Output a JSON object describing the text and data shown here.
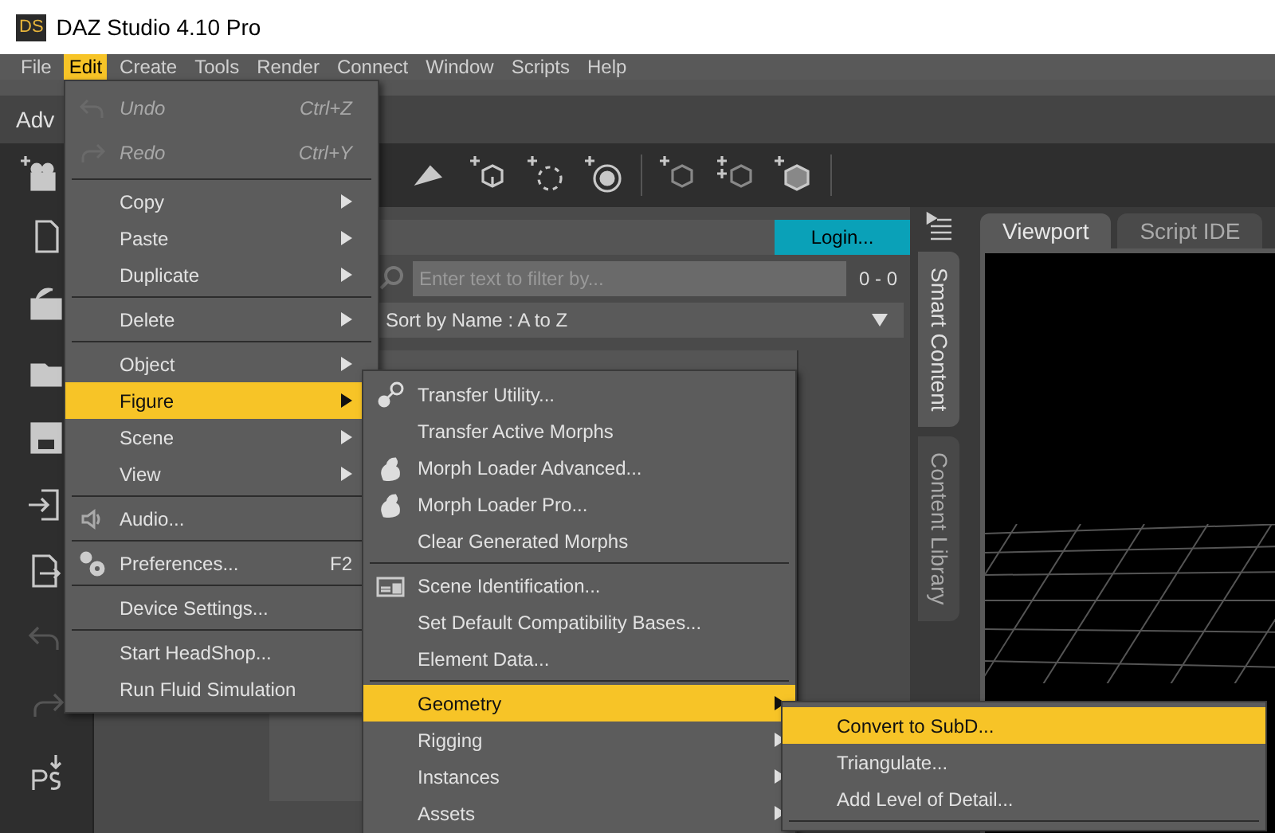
{
  "window": {
    "title": "DAZ Studio 4.10 Pro",
    "logo": "DS"
  },
  "menubar": [
    {
      "label": "File",
      "selected": false
    },
    {
      "label": "Edit",
      "selected": true
    },
    {
      "label": "Create",
      "selected": false
    },
    {
      "label": "Tools",
      "selected": false
    },
    {
      "label": "Render",
      "selected": false
    },
    {
      "label": "Connect",
      "selected": false
    },
    {
      "label": "Window",
      "selected": false
    },
    {
      "label": "Scripts",
      "selected": false
    },
    {
      "label": "Help",
      "selected": false
    }
  ],
  "layout_tab": "Adv",
  "content_panel": {
    "login_button": "Login...",
    "filter": {
      "placeholder": "Enter text to filter by..."
    },
    "count": "0 - 0",
    "sort": "Sort by Name : A to Z"
  },
  "side_tabs": [
    {
      "label": "Smart Content",
      "selected": true
    },
    {
      "label": "Content Library",
      "selected": false
    }
  ],
  "viewport_tabs": [
    {
      "label": "Viewport",
      "selected": true
    },
    {
      "label": "Script IDE",
      "selected": false
    }
  ],
  "menus": [
    {
      "items": [
        {
          "kind": "item",
          "label": "Undo",
          "shortcut": "Ctrl+Z",
          "disabled": true,
          "submenu": false,
          "selected": false
        },
        {
          "kind": "item",
          "label": "Redo",
          "shortcut": "Ctrl+Y",
          "disabled": true,
          "submenu": false,
          "selected": false
        },
        {
          "kind": "separator"
        },
        {
          "kind": "item",
          "label": "Copy",
          "disabled": false,
          "submenu": true,
          "selected": false
        },
        {
          "kind": "item",
          "label": "Paste",
          "disabled": false,
          "submenu": true,
          "selected": false
        },
        {
          "kind": "item",
          "label": "Duplicate",
          "disabled": false,
          "submenu": true,
          "selected": false
        },
        {
          "kind": "separator"
        },
        {
          "kind": "item",
          "label": "Delete",
          "disabled": false,
          "submenu": true,
          "selected": false
        },
        {
          "kind": "separator"
        },
        {
          "kind": "item",
          "label": "Object",
          "disabled": false,
          "submenu": true,
          "selected": false
        },
        {
          "kind": "item",
          "label": "Figure",
          "disabled": false,
          "submenu": true,
          "selected": true
        },
        {
          "kind": "item",
          "label": "Scene",
          "disabled": false,
          "submenu": true,
          "selected": false
        },
        {
          "kind": "item",
          "label": "View",
          "disabled": false,
          "submenu": true,
          "selected": false
        },
        {
          "kind": "separator"
        },
        {
          "kind": "item",
          "label": "Audio...",
          "disabled": false,
          "submenu": false,
          "selected": false
        },
        {
          "kind": "separator"
        },
        {
          "kind": "item",
          "label": "Preferences...",
          "shortcut": "F2",
          "disabled": false,
          "submenu": false,
          "selected": false
        },
        {
          "kind": "separator"
        },
        {
          "kind": "item",
          "label": "Device Settings...",
          "disabled": false,
          "submenu": false,
          "selected": false
        },
        {
          "kind": "separator"
        },
        {
          "kind": "item",
          "label": "Start HeadShop...",
          "disabled": false,
          "submenu": false,
          "selected": false
        },
        {
          "kind": "item",
          "label": "Run Fluid Simulation",
          "disabled": false,
          "submenu": false,
          "selected": false
        }
      ]
    },
    {
      "items": [
        {
          "kind": "item",
          "label": "Transfer Utility...",
          "disabled": false,
          "submenu": false,
          "selected": false
        },
        {
          "kind": "item",
          "label": "Transfer Active Morphs",
          "disabled": false,
          "submenu": false,
          "selected": false
        },
        {
          "kind": "item",
          "label": "Morph Loader Advanced...",
          "disabled": false,
          "submenu": false,
          "selected": false
        },
        {
          "kind": "item",
          "label": "Morph Loader Pro...",
          "disabled": false,
          "submenu": false,
          "selected": false
        },
        {
          "kind": "item",
          "label": "Clear Generated Morphs",
          "disabled": false,
          "submenu": false,
          "selected": false
        },
        {
          "kind": "separator"
        },
        {
          "kind": "item",
          "label": "Scene Identification...",
          "disabled": false,
          "submenu": false,
          "selected": false
        },
        {
          "kind": "item",
          "label": "Set Default Compatibility Bases...",
          "disabled": false,
          "submenu": false,
          "selected": false
        },
        {
          "kind": "item",
          "label": "Element Data...",
          "disabled": false,
          "submenu": false,
          "selected": false
        },
        {
          "kind": "separator"
        },
        {
          "kind": "item",
          "label": "Geometry",
          "disabled": false,
          "submenu": true,
          "selected": true
        },
        {
          "kind": "item",
          "label": "Rigging",
          "disabled": false,
          "submenu": true,
          "selected": false
        },
        {
          "kind": "item",
          "label": "Instances",
          "disabled": false,
          "submenu": true,
          "selected": false
        },
        {
          "kind": "item",
          "label": "Assets",
          "disabled": false,
          "submenu": true,
          "selected": false
        }
      ]
    },
    {
      "items": [
        {
          "kind": "item",
          "label": "Convert to SubD...",
          "disabled": false,
          "submenu": false,
          "selected": true
        },
        {
          "kind": "item",
          "label": "Triangulate...",
          "disabled": false,
          "submenu": false,
          "selected": false
        },
        {
          "kind": "item",
          "label": "Add Level of Detail...",
          "disabled": false,
          "submenu": false,
          "selected": false
        },
        {
          "kind": "separator"
        }
      ]
    }
  ]
}
